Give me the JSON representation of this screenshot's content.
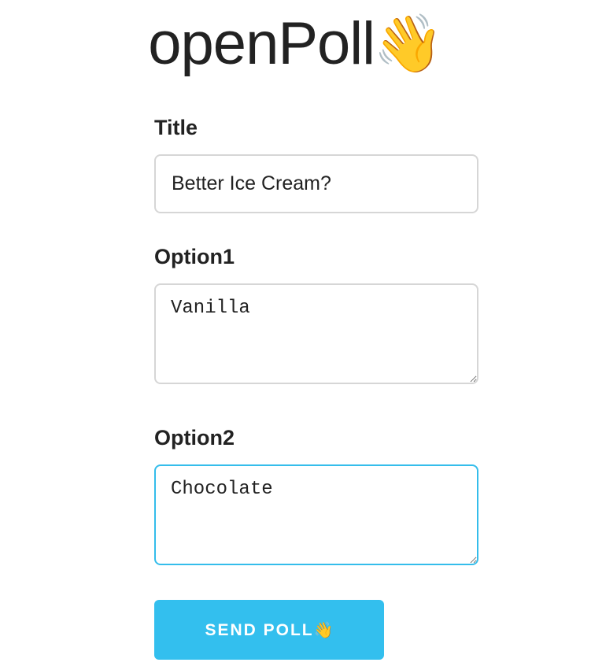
{
  "brand": {
    "name": "openPoll",
    "emoji": "👋"
  },
  "form": {
    "title": {
      "label": "Title",
      "value": "Better Ice Cream?"
    },
    "option1": {
      "label": "Option1",
      "value": "Vanilla"
    },
    "option2": {
      "label": "Option2",
      "value": "Chocolate"
    },
    "submit": {
      "label": "SEND POLL",
      "emoji": "👋"
    }
  },
  "colors": {
    "accent": "#33bfee",
    "focus_border": "#34bdeb",
    "input_border": "#d6d6d6",
    "text": "#222222"
  },
  "icons": {
    "brand_icon": "waving-hand-icon",
    "button_icon": "waving-hand-icon"
  }
}
